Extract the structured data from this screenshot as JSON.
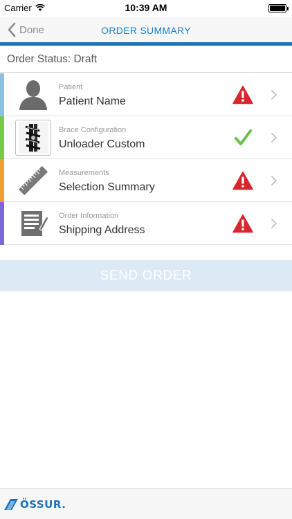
{
  "status_bar": {
    "carrier": "Carrier",
    "time": "10:39 AM",
    "battery_level": 1.0
  },
  "nav": {
    "back_label": "Done",
    "title": "ORDER SUMMARY",
    "accent_color": "#1c73b8"
  },
  "order_status": "Order Status: Draft",
  "rows": [
    {
      "caption": "Patient",
      "value": "Patient Name",
      "accent": "#8fc0e3",
      "icon": "patient-silhouette-icon",
      "status": "warning"
    },
    {
      "caption": "Brace Configuration",
      "value": "Unloader Custom",
      "accent": "#7ac943",
      "icon": "brace-image-icon",
      "status": "complete"
    },
    {
      "caption": "Measurements",
      "value": "Selection Summary",
      "accent": "#f0a030",
      "icon": "ruler-icon",
      "status": "warning"
    },
    {
      "caption": "Order Information",
      "value": "Shipping Address",
      "accent": "#7b68d8",
      "icon": "document-icon",
      "status": "warning"
    }
  ],
  "send_button": {
    "label": "SEND ORDER",
    "enabled": false
  },
  "footer": {
    "logo_text": "ÖSSUR."
  },
  "colors": {
    "warning": "#d7262e",
    "complete": "#6cc04a",
    "send_disabled_bg": "#dbeaf5"
  }
}
